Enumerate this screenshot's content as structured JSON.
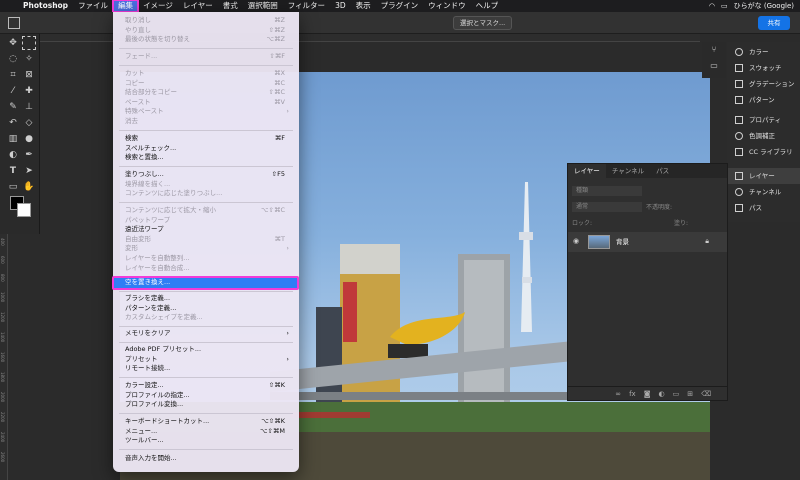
{
  "menubar": {
    "app": "Photoshop",
    "items": [
      "ファイル",
      "編集",
      "イメージ",
      "レイヤー",
      "書式",
      "選択範囲",
      "フィルター",
      "3D",
      "表示",
      "プラグイン",
      "ウィンドウ",
      "ヘルプ"
    ],
    "input_method": "ひらがな (Google)"
  },
  "optionsbar": {
    "select_mask": "選択とマスク...",
    "share": "共有"
  },
  "edit_menu": {
    "items": [
      {
        "label": "取り消し",
        "shortcut": "⌘Z",
        "disabled": true
      },
      {
        "label": "やり直し",
        "shortcut": "⇧⌘Z",
        "disabled": true
      },
      {
        "label": "最後の状態を切り替え",
        "shortcut": "⌥⌘Z",
        "disabled": true
      },
      {
        "label": "フェード...",
        "shortcut": "⇧⌘F",
        "disabled": true
      },
      {
        "label": "カット",
        "shortcut": "⌘X",
        "disabled": true
      },
      {
        "label": "コピー",
        "shortcut": "⌘C",
        "disabled": true
      },
      {
        "label": "結合部分をコピー",
        "shortcut": "⇧⌘C",
        "disabled": true
      },
      {
        "label": "ペースト",
        "shortcut": "⌘V",
        "disabled": true
      },
      {
        "label": "特殊ペースト",
        "shortcut": "›",
        "disabled": true
      },
      {
        "label": "消去",
        "shortcut": "",
        "disabled": true
      },
      {
        "label": "検索",
        "shortcut": "⌘F",
        "disabled": false
      },
      {
        "label": "スペルチェック...",
        "shortcut": "",
        "disabled": false
      },
      {
        "label": "検索と置換...",
        "shortcut": "",
        "disabled": false
      },
      {
        "label": "塗りつぶし...",
        "shortcut": "⇧F5",
        "disabled": false
      },
      {
        "label": "境界線を描く...",
        "shortcut": "",
        "disabled": true
      },
      {
        "label": "コンテンツに応じた塗りつぶし...",
        "shortcut": "",
        "disabled": true
      },
      {
        "label": "コンテンツに応じて拡大・縮小",
        "shortcut": "⌥⇧⌘C",
        "disabled": true
      },
      {
        "label": "パペットワープ",
        "shortcut": "",
        "disabled": true
      },
      {
        "label": "遠近法ワープ",
        "shortcut": "",
        "disabled": false
      },
      {
        "label": "自由変形",
        "shortcut": "⌘T",
        "disabled": true
      },
      {
        "label": "変形",
        "shortcut": "›",
        "disabled": true
      },
      {
        "label": "レイヤーを自動整列...",
        "shortcut": "",
        "disabled": true
      },
      {
        "label": "レイヤーを自動合成...",
        "shortcut": "",
        "disabled": true
      },
      {
        "label": "空を置き換え...",
        "shortcut": "",
        "disabled": false,
        "highlighted": true
      },
      {
        "label": "ブラシを定義...",
        "shortcut": "",
        "disabled": false
      },
      {
        "label": "パターンを定義...",
        "shortcut": "",
        "disabled": false
      },
      {
        "label": "カスタムシェイプを定義...",
        "shortcut": "",
        "disabled": true
      },
      {
        "label": "メモリをクリア",
        "shortcut": "›",
        "disabled": false
      },
      {
        "label": "Adobe PDF プリセット...",
        "shortcut": "",
        "disabled": false
      },
      {
        "label": "プリセット",
        "shortcut": "›",
        "disabled": false
      },
      {
        "label": "リモート接続...",
        "shortcut": "",
        "disabled": false
      },
      {
        "label": "カラー設定...",
        "shortcut": "⇧⌘K",
        "disabled": false
      },
      {
        "label": "プロファイルの指定...",
        "shortcut": "",
        "disabled": false
      },
      {
        "label": "プロファイル変換...",
        "shortcut": "",
        "disabled": false
      },
      {
        "label": "キーボードショートカット...",
        "shortcut": "⌥⇧⌘K",
        "disabled": false
      },
      {
        "label": "メニュー...",
        "shortcut": "⌥⇧⌘M",
        "disabled": false
      },
      {
        "label": "ツールバー...",
        "shortcut": "",
        "disabled": false
      },
      {
        "label": "音声入力を開始...",
        "shortcut": "",
        "disabled": false
      }
    ]
  },
  "right_panel": {
    "items": [
      "カラー",
      "スウォッチ",
      "グラデーション",
      "パターン",
      "プロパティ",
      "色調補正",
      "CC ライブラリ",
      "レイヤー",
      "チャンネル",
      "パス"
    ]
  },
  "layers_panel": {
    "tabs": [
      "レイヤー",
      "チャンネル",
      "パス"
    ],
    "filter_label": "種類",
    "blend_mode": "通常",
    "opacity_label": "不透明度:",
    "lock_label": "ロック:",
    "fill_label": "塗り:",
    "layer_name": "背景"
  },
  "ruler": [
    "400",
    "600",
    "800",
    "1000",
    "1200",
    "1400",
    "1600",
    "1800",
    "2000",
    "2200",
    "2400",
    "2600",
    "2800"
  ]
}
